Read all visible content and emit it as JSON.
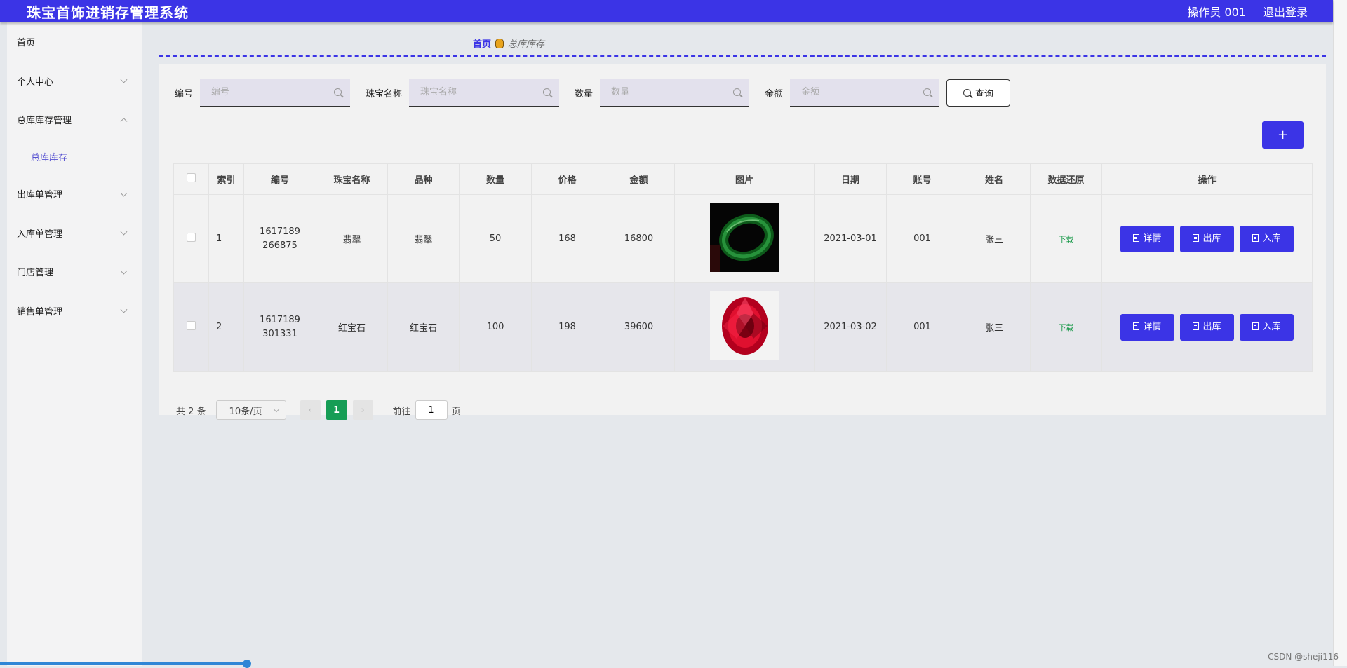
{
  "header": {
    "title": "珠宝首饰进销存管理系统",
    "operator": "操作员 001",
    "logout": "退出登录"
  },
  "sidebar": {
    "items": [
      {
        "label": "首页"
      },
      {
        "label": "个人中心"
      },
      {
        "label": "总库库存管理"
      },
      {
        "label": "总库库存"
      },
      {
        "label": "出库单管理"
      },
      {
        "label": "入库单管理"
      },
      {
        "label": "门店管理"
      },
      {
        "label": "销售单管理"
      }
    ]
  },
  "breadcrumb": {
    "home": "首页",
    "current": "总库库存"
  },
  "search": {
    "fields": [
      {
        "label": "编号",
        "placeholder": "编号"
      },
      {
        "label": "珠宝名称",
        "placeholder": "珠宝名称"
      },
      {
        "label": "数量",
        "placeholder": "数量"
      },
      {
        "label": "金额",
        "placeholder": "金额"
      }
    ],
    "query_label": "查询"
  },
  "add_label": "+",
  "table": {
    "columns": [
      "索引",
      "编号",
      "珠宝名称",
      "品种",
      "数量",
      "价格",
      "金额",
      "图片",
      "日期",
      "账号",
      "姓名",
      "数据还原",
      "操作"
    ],
    "rows": [
      {
        "index": "1",
        "code": "1617189266875",
        "name": "翡翠",
        "variety": "翡翠",
        "qty": "50",
        "price": "168",
        "amount": "16800",
        "image": "jade-bangle",
        "date": "2021-03-01",
        "account": "001",
        "person": "张三",
        "restore": "下载"
      },
      {
        "index": "2",
        "code": "1617189301331",
        "name": "红宝石",
        "variety": "红宝石",
        "qty": "100",
        "price": "198",
        "amount": "39600",
        "image": "ruby-gem",
        "date": "2021-03-02",
        "account": "001",
        "person": "张三",
        "restore": "下载"
      }
    ],
    "actions": {
      "detail": "详情",
      "out": "出库",
      "in": "入库"
    }
  },
  "pagination": {
    "total": "共 2 条",
    "page_size": "10条/页",
    "current_page": "1",
    "goto_label": "前往",
    "goto_value": "1",
    "page_suffix": "页"
  },
  "watermark": "CSDN @sheji116",
  "colors": {
    "brand": "#3b34e6",
    "success": "#169d55"
  }
}
